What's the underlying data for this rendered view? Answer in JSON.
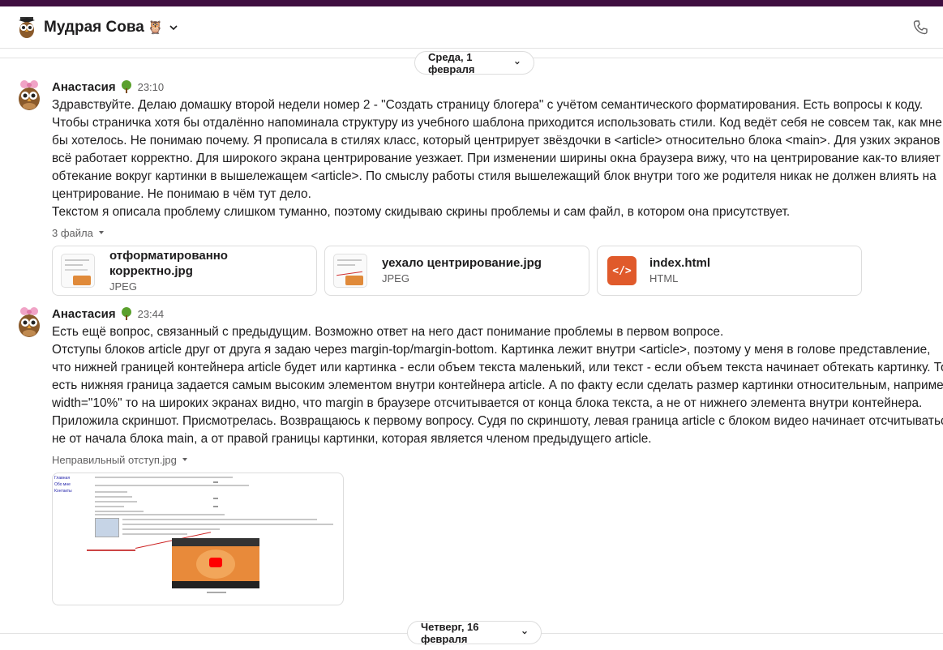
{
  "header": {
    "channel_name": "Мудрая Сова",
    "title_emoji": "🦉"
  },
  "dividers": [
    {
      "label": "Среда, 1 февраля"
    },
    {
      "label": "Четверг, 16 февраля"
    }
  ],
  "messages": [
    {
      "author": "Анастасия",
      "author_emoji": "🌳",
      "time": "23:10",
      "lines": [
        "Здравствуйте. Делаю домашку второй недели номер 2 - \"Создать страницу блогера\" с учётом семантического форматирования. Есть вопросы к коду.",
        "Чтобы страничка хотя бы отдалённо напоминала структуру из учебного шаблона приходится использовать стили. Код ведёт себя не совсем так, как мне",
        "бы хотелось. Не понимаю почему. Я прописала в стилях класс, который центрирует звёздочки в <article> относительно блока <main>. Для узких экранов",
        "всё работает корректно. Для широкого экрана центрирование уезжает. При изменении ширины окна браузера вижу, что на центрирование как-то влияет",
        "обтекание вокруг картинки в вышележащем <article>. По смыслу работы стиля вышележащий блок внутри того же родителя никак не должен влиять на",
        "центрирование. Не понимаю в чём тут дело.",
        "Текстом я описала проблему слишком туманно, поэтому скидываю скрины проблемы и сам файл, в котором она присутствует."
      ],
      "files_label": "3 файла",
      "files": [
        {
          "name": "отформатированно корректно.jpg",
          "type": "JPEG"
        },
        {
          "name": "уехало центрирование.jpg",
          "type": "JPEG"
        },
        {
          "name": "index.html",
          "type": "HTML"
        }
      ]
    },
    {
      "author": "Анастасия",
      "author_emoji": "🌳",
      "time": "23:44",
      "lines": [
        "Есть ещё вопрос, связанный с предыдущим. Возможно ответ на него даст понимание проблемы в первом вопросе.",
        "Отступы блоков article друг от друга я задаю через margin-top/margin-bottom. Картинка лежит внутри <article>, поэтому у меня в голове представление,",
        "что нижней границей контейнера article будет или картинка - если объем текста маленький, или текст - если объем текста начинает обтекать картинку. То",
        "есть нижняя граница задается самым высоким элементом внутри контейнера article. А по факту если сделать размер картинки относительным, например",
        "width=\"10%\" то на широких экранах видно, что margin в браузере отсчитывается от конца блока текста, а не от нижнего элемента внутри контейнера.",
        "Приложила скриншот. Присмотрелась. Возвращаюсь к первому вопросу. Судя по скриншоту, левая граница article с блоком видео начинает отсчитываться",
        "не от начала блока main, а от правой границы картинки, которая является членом предыдущего article."
      ],
      "file_label": "Неправильный отступ.jpg",
      "screenshot_nav": [
        "Главная",
        "Обо мне",
        "Контакты"
      ]
    }
  ],
  "colors": {
    "top_strip": "#3f0e40",
    "html_icon": "#e05a2b",
    "muted_text": "#616061"
  }
}
